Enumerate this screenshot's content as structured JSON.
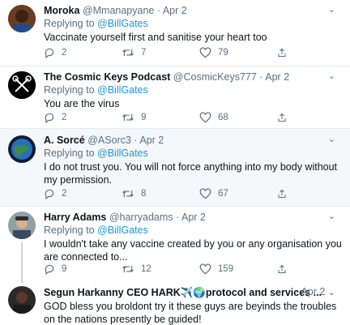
{
  "tweets": [
    {
      "name": "Moroka",
      "handle": "@Mmanapyane",
      "date": "Apr 2",
      "replying_label": "Replying to",
      "replying_to": "@BillGates",
      "text": "Vaccinate yourself first and sanitise your heart too",
      "replies": "2",
      "retweets": "7",
      "likes": "79"
    },
    {
      "name": "The Cosmic Keys Podcast",
      "handle": "@CosmicKeys777",
      "date": "Apr 2",
      "replying_label": "Replying to",
      "replying_to": "@BillGates",
      "text": "You are the virus",
      "replies": "2",
      "retweets": "9",
      "likes": "68"
    },
    {
      "name": "A. Sorcé",
      "handle": "@ASorc3",
      "date": "Apr 2",
      "replying_label": "Replying to",
      "replying_to": "@BillGates",
      "text": "I do not trust you. You will not force anything into my body without my permission.",
      "replies": "2",
      "retweets": "8",
      "likes": "67"
    },
    {
      "name": "Harry Adams",
      "handle": "@harryadams",
      "date": "Apr 2",
      "replying_label": "Replying to",
      "replying_to": "@BillGates",
      "text": "I wouldn't take any vaccine created by you or any organisation you are connected to...",
      "replies": "9",
      "retweets": "12",
      "likes": "159"
    },
    {
      "name": "Segun Harkanny CEO HARK✈️🌍protocol and services ...",
      "handle": "",
      "date": "Apr 2",
      "text": "GOD bless you broldont try it these guys are beyinds the troubles on the nations presently be guided!"
    }
  ],
  "separator": "·",
  "colors": {
    "accent": "#1b95e0",
    "muted": "#5b7083",
    "border": "#e6ecf0",
    "highlight_bg": "#f5f8fa"
  }
}
